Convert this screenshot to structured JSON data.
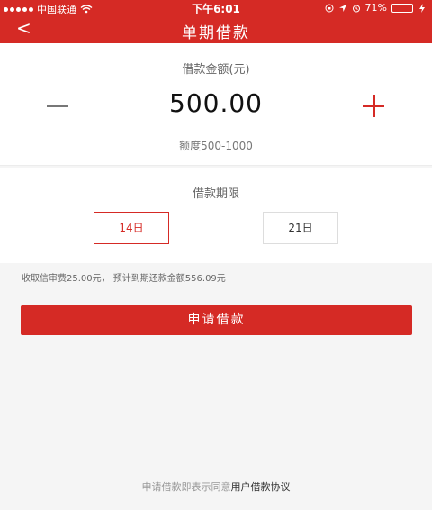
{
  "status_bar": {
    "carrier": "中国联通",
    "time": "下午6:01",
    "battery": "71%",
    "battery_level": 0.71
  },
  "nav": {
    "back_glyph": "<",
    "title": "单期借款"
  },
  "amount": {
    "label": "借款金额(元)",
    "value": "500.00",
    "range": "额度500-1000"
  },
  "period": {
    "label": "借款期限",
    "options": [
      "14日",
      "21日"
    ],
    "selected": "14日"
  },
  "fee_text": "收取信审费25.00元，  预计到期还款金额556.09元",
  "apply_button": "申请借款",
  "agreement": {
    "prefix": "申请借款即表示同意",
    "link": "用户借款协议"
  },
  "colors": {
    "brand": "#d52a25",
    "battery_green": "#4cd964"
  }
}
